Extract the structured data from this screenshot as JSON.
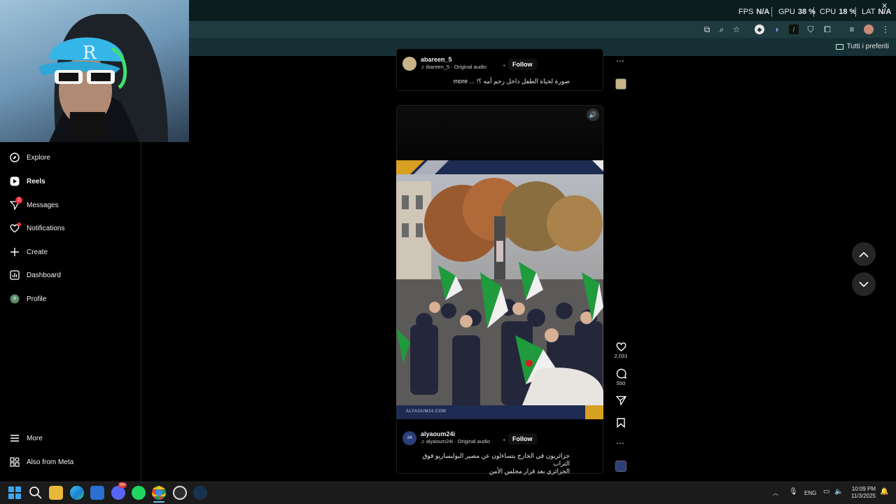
{
  "overlay": {
    "fps_label": "FPS",
    "fps_value": "N/A",
    "gpu_label": "GPU",
    "gpu_value": "38 %",
    "cpu_label": "CPU",
    "cpu_value": "18 %",
    "lat_label": "LAT",
    "lat_value": "N/A"
  },
  "browser": {
    "bookmarks_label": "Tutti i preferiti"
  },
  "sidebar": {
    "items": [
      {
        "label": "Explore",
        "icon": "compass-icon"
      },
      {
        "label": "Reels",
        "icon": "reels-icon"
      },
      {
        "label": "Messages",
        "icon": "messenger-icon",
        "badge": "2"
      },
      {
        "label": "Notifications",
        "icon": "heart-icon"
      },
      {
        "label": "Create",
        "icon": "plus-icon"
      },
      {
        "label": "Dashboard",
        "icon": "chart-icon"
      },
      {
        "label": "Profile",
        "icon": "avatar-icon"
      }
    ],
    "bottom": [
      {
        "label": "More",
        "icon": "hamburger-icon"
      },
      {
        "label": "Also from Meta",
        "icon": "meta-icon"
      }
    ]
  },
  "reel_prev": {
    "username": "abareen_5",
    "audio": "ibareen_5 · Original audio",
    "follow": "Follow",
    "caption": "صورة لحياة الطفل داخل رحم أمه ؟! ... more"
  },
  "reel_main": {
    "video_watermark": "ALYAOUM24.COM",
    "username": "alyaoum24i",
    "audio": "alyaoum24i · Original audio",
    "follow": "Follow",
    "caption_line1": "جزائريون في الخارج يتساءلون عن مصير البوليساريو فوق التراب",
    "caption_line2": "الجزائري بعد قرار مجلس الأمن",
    "likes": "2,031",
    "comments": "550"
  },
  "taskbar": {
    "lang": "ENG",
    "time": "10:09 PM",
    "date": "11/3/2025",
    "discord_badge": "99+"
  },
  "colors": {
    "accent_red": "#ff3040",
    "titlebar": "#0c1d20",
    "addressbar": "#1f3b3f"
  }
}
